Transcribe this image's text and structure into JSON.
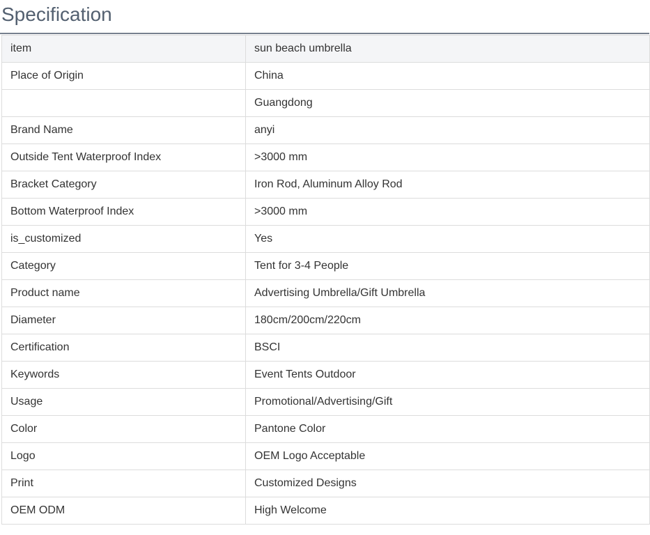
{
  "section": {
    "title": "Specification"
  },
  "spec_table": {
    "header": {
      "key": "item",
      "value": "sun beach umbrella"
    },
    "rows": [
      {
        "key": "Place of Origin",
        "value": "China"
      },
      {
        "key": "",
        "value": "Guangdong"
      },
      {
        "key": "Brand Name",
        "value": "anyi"
      },
      {
        "key": "Outside Tent Waterproof Index",
        "value": ">3000 mm"
      },
      {
        "key": "Bracket Category",
        "value": "Iron Rod, Aluminum Alloy Rod"
      },
      {
        "key": "Bottom Waterproof Index",
        "value": ">3000 mm"
      },
      {
        "key": "is_customized",
        "value": "Yes"
      },
      {
        "key": "Category",
        "value": "Tent for 3-4 People"
      },
      {
        "key": "Product name",
        "value": "Advertising Umbrella/Gift Umbrella"
      },
      {
        "key": "Diameter",
        "value": "180cm/200cm/220cm"
      },
      {
        "key": "Certification",
        "value": "BSCI"
      },
      {
        "key": "Keywords",
        "value": "Event Tents Outdoor"
      },
      {
        "key": "Usage",
        "value": "Promotional/Advertising/Gift"
      },
      {
        "key": "Color",
        "value": "Pantone Color"
      },
      {
        "key": "Logo",
        "value": "OEM Logo Acceptable"
      },
      {
        "key": "Print",
        "value": "Customized Designs"
      },
      {
        "key": "OEM ODM",
        "value": "High Welcome"
      }
    ]
  },
  "colors": {
    "title": "#536070",
    "rule": "#76808e",
    "header_bg": "#f4f5f7",
    "border": "#dcdcdc",
    "text": "#333333"
  }
}
